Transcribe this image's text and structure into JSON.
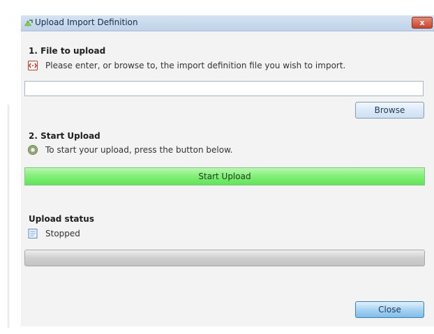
{
  "window": {
    "title": "Upload Import Definition",
    "close_glyph": "x"
  },
  "section1": {
    "heading": "1. File to upload",
    "hint": "Please enter, or browse to, the import definition file you wish to import.",
    "hint_icon": "xml-file-icon",
    "file_value": "",
    "file_placeholder": "",
    "browse_label": "Browse"
  },
  "section2": {
    "heading": "2. Start Upload",
    "hint": "To start your upload, press the button below.",
    "hint_icon": "gear-icon",
    "start_label": "Start Upload"
  },
  "status": {
    "heading": "Upload status",
    "icon": "document-icon",
    "value": "Stopped",
    "progress": 0
  },
  "footer": {
    "close_label": "Close"
  },
  "colors": {
    "start_button": "#7fef75",
    "title_bar": "#c8d9ee",
    "close_button": "#a9d4f2"
  }
}
